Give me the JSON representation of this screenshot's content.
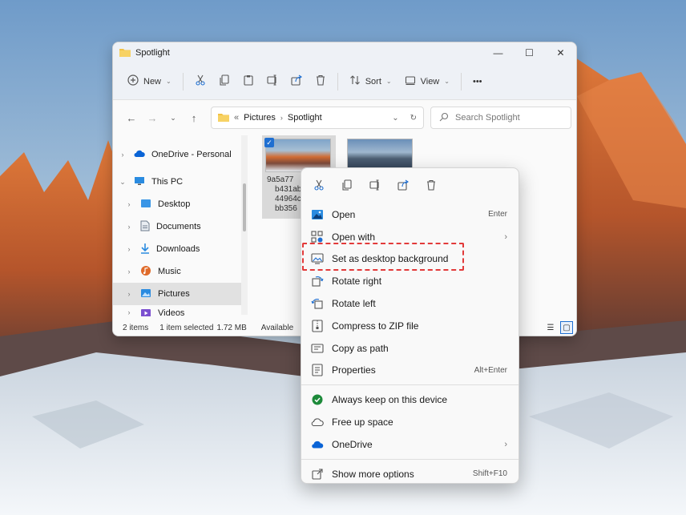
{
  "window": {
    "title": "Spotlight",
    "controls": {
      "minimize": "—",
      "maximize": "☐",
      "close": "✕"
    }
  },
  "toolbar": {
    "new_label": "New",
    "sort_label": "Sort",
    "view_label": "View",
    "more_label": "•••"
  },
  "address": {
    "prefix": "«",
    "crumbs": [
      "Pictures",
      "Spotlight"
    ],
    "search_placeholder": "Search Spotlight"
  },
  "nav": {
    "items": [
      {
        "label": "OneDrive - Personal",
        "icon": "cloud-icon",
        "color": "#0a64d6"
      },
      {
        "label": "This PC",
        "icon": "monitor-icon",
        "color": "#2a8be0"
      },
      {
        "label": "Desktop",
        "icon": "desktop-icon",
        "color": "#3a96e6"
      },
      {
        "label": "Documents",
        "icon": "documents-icon",
        "color": "#6d7b8c"
      },
      {
        "label": "Downloads",
        "icon": "download-icon",
        "color": "#2a8be0"
      },
      {
        "label": "Music",
        "icon": "music-icon",
        "color": "#e06b2a"
      },
      {
        "label": "Pictures",
        "icon": "pictures-icon",
        "color": "#2a8be0"
      },
      {
        "label": "Videos",
        "icon": "videos-icon",
        "color": "#7b4fd0"
      }
    ]
  },
  "files": {
    "selected_caption": [
      "9a5a77",
      "b431ab",
      "44964c",
      "bb356"
    ]
  },
  "status": {
    "items_count": "2 items",
    "selection": "1 item selected",
    "size": "1.72 MB",
    "availability": "Available"
  },
  "context_menu": {
    "items": [
      {
        "label": "Open",
        "shortcut": "Enter",
        "icon": "image-icon"
      },
      {
        "label": "Open with",
        "shortcut": "",
        "icon": "open-with-icon",
        "submenu": true
      },
      {
        "label": "Set as desktop background",
        "shortcut": "",
        "icon": "wallpaper-icon",
        "highlighted": true
      },
      {
        "label": "Rotate right",
        "shortcut": "",
        "icon": "rotate-right-icon"
      },
      {
        "label": "Rotate left",
        "shortcut": "",
        "icon": "rotate-left-icon"
      },
      {
        "label": "Compress to ZIP file",
        "shortcut": "",
        "icon": "zip-icon"
      },
      {
        "label": "Copy as path",
        "shortcut": "",
        "icon": "copy-path-icon"
      },
      {
        "label": "Properties",
        "shortcut": "Alt+Enter",
        "icon": "properties-icon"
      }
    ],
    "onedrive_items": [
      {
        "label": "Always keep on this device",
        "icon": "keep-icon"
      },
      {
        "label": "Free up space",
        "icon": "cloud-outline-icon"
      },
      {
        "label": "OneDrive",
        "icon": "onedrive-icon",
        "submenu": true
      }
    ],
    "more": {
      "label": "Show more options",
      "shortcut": "Shift+F10"
    }
  },
  "colors": {
    "accent": "#1f6fd1",
    "highlight_border": "#e23a3a",
    "folder": "#f3c243"
  }
}
